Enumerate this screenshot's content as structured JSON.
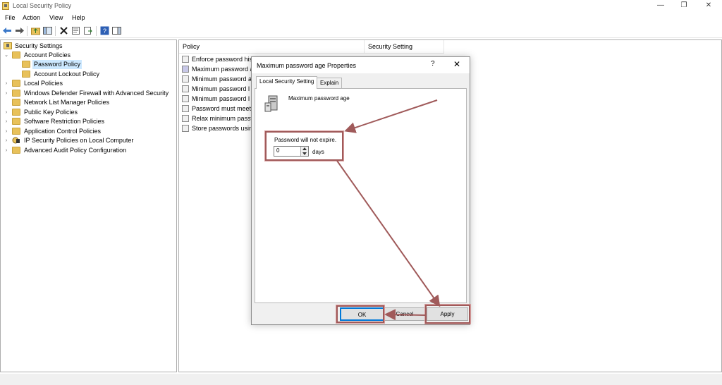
{
  "window": {
    "title": "Local Security Policy",
    "minimize": "—",
    "restore": "❐",
    "close": "✕"
  },
  "menu": [
    "File",
    "Action",
    "View",
    "Help"
  ],
  "tree": {
    "items": [
      {
        "label": "Security Settings"
      },
      {
        "label": "Account Policies"
      },
      {
        "label": "Password Policy"
      },
      {
        "label": "Account Lockout Policy"
      },
      {
        "label": "Local Policies"
      },
      {
        "label": "Windows Defender Firewall with Advanced Security"
      },
      {
        "label": "Network List Manager Policies"
      },
      {
        "label": "Public Key Policies"
      },
      {
        "label": "Software Restriction Policies"
      },
      {
        "label": "Application Control Policies"
      },
      {
        "label": "IP Security Policies on Local Computer"
      },
      {
        "label": "Advanced Audit Policy Configuration"
      }
    ]
  },
  "list": {
    "col_policy": "Policy",
    "col_setting": "Security Setting",
    "rows": [
      "Enforce password hist",
      "Maximum password a",
      "Minimum password a",
      "Minimum password l",
      "Minimum password l",
      "Password must meet",
      "Relax minimum passw",
      "Store passwords using"
    ]
  },
  "dialog": {
    "title": "Maximum password age Properties",
    "help": "?",
    "close": "✕",
    "tabs": [
      "Local Security Setting",
      "Explain"
    ],
    "policy_name": "Maximum password age",
    "status_text": "Password will not expire.",
    "days_value": "0",
    "days_label": "days",
    "ok": "OK",
    "cancel": "Cancel",
    "apply": "Apply"
  },
  "colors": {
    "annotation": "#a05a5a",
    "selection": "#cce8ff",
    "folder": "#e8c15a"
  }
}
